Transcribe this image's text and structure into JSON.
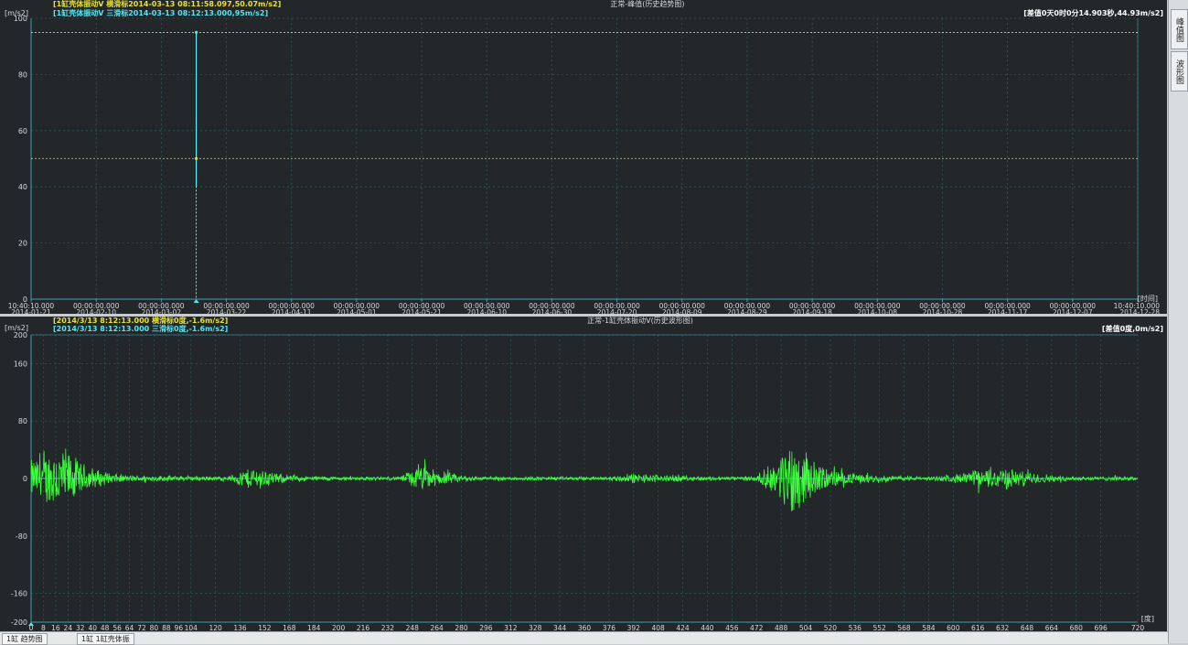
{
  "colors": {
    "bg": "#24272a",
    "axis": "#35a7b8",
    "grid": "#2e5560",
    "text": "#d8d8d8",
    "cursor_yellow": "#e6e232",
    "cursor_cyan": "#52e8f2",
    "wave": "#3cff3c",
    "trend": "#5ff0ff"
  },
  "top": {
    "title": "正常-峰值(历史趋势图)",
    "unit": "[m/s2]",
    "legend1": "[1缸壳体振动V 横滑标2014-03-13 08:11:58.097,50.07m/s2]",
    "legend2": "[1缸壳体振动V 三滑标2014-03-13 08:12:13.000,95m/s2]",
    "delta": "[差值0天0时0分14.903秒,44.93m/s2]",
    "axis_unit": "[时间]",
    "xlabels": [
      {
        "t": "10:40:10.000",
        "d": "2014-01-21"
      },
      {
        "t": "00:00:00.000",
        "d": "2014-02-10"
      },
      {
        "t": "00:00:00.000",
        "d": "2014-03-02"
      },
      {
        "t": "00:00:00.000",
        "d": "2014-03-22"
      },
      {
        "t": "00:00:00.000",
        "d": "2014-04-11"
      },
      {
        "t": "00:00:00.000",
        "d": "2014-05-01"
      },
      {
        "t": "00:00:00.000",
        "d": "2014-05-21"
      },
      {
        "t": "00:00:00.000",
        "d": "2014-06-10"
      },
      {
        "t": "00:00:00.000",
        "d": "2014-06-30"
      },
      {
        "t": "00:00:00.000",
        "d": "2014-07-20"
      },
      {
        "t": "00:00:00.000",
        "d": "2014-08-09"
      },
      {
        "t": "00:00:00.000",
        "d": "2014-08-29"
      },
      {
        "t": "00:00:00.000",
        "d": "2014-09-18"
      },
      {
        "t": "00:00:00.000",
        "d": "2014-10-08"
      },
      {
        "t": "00:00:00.000",
        "d": "2014-10-28"
      },
      {
        "t": "00:00:00.000",
        "d": "2014-11-17"
      },
      {
        "t": "00:00:00.000",
        "d": "2014-12-07"
      },
      {
        "t": "10:40:10.000",
        "d": "2014-12-28"
      }
    ]
  },
  "bottom": {
    "title": "正常-1缸壳体振动V(历史波形图)",
    "unit": "[m/s2]",
    "legend1": "[2014/3/13 8:12:13.000 横滑标0度,-1.6m/s2]",
    "legend2": "[2014/3/13 8:12:13.000 三滑标0度,-1.6m/s2]",
    "delta": "[差值0度,0m/s2]",
    "axis_unit": "[度]"
  },
  "sidebar": {
    "tab1": "峰值图",
    "tab2": "波形图"
  },
  "statusbar": {
    "tab1": "1缸 趋势图",
    "tab2": "1缸 1缸壳体振"
  },
  "chart_data": [
    {
      "type": "line",
      "title": "正常-峰值(历史趋势图)",
      "xlabel": "[时间]",
      "ylabel": "[m/s2]",
      "ylim": [
        0,
        100
      ],
      "yticks": [
        0,
        20,
        40,
        60,
        80,
        100
      ],
      "xlim": [
        "2014-01-21 10:40:10",
        "2014-12-28 10:40:10"
      ],
      "series": [
        {
          "x": [
            "2014-03-13 08:11:58",
            "2014-03-13 08:12:13"
          ],
          "y": [
            50.07,
            95
          ]
        }
      ],
      "cursors": [
        {
          "x": "2014-03-13 08:11:58.097",
          "y": 50.07
        },
        {
          "x": "2014-03-13 08:12:13.000",
          "y": 95
        }
      ],
      "grid": true
    },
    {
      "type": "line",
      "title": "正常-1缸壳体振动V(历史波形图)",
      "xlabel": "[度]",
      "ylabel": "[m/s2]",
      "xlim": [
        0,
        720
      ],
      "ylim": [
        -200,
        200
      ],
      "xticks": [
        0,
        8,
        16,
        24,
        32,
        40,
        48,
        56,
        64,
        72,
        80,
        88,
        96,
        104,
        120,
        136,
        152,
        168,
        184,
        200,
        216,
        232,
        248,
        264,
        280,
        296,
        312,
        328,
        344,
        360,
        376,
        392,
        408,
        424,
        440,
        456,
        472,
        488,
        504,
        520,
        536,
        552,
        568,
        584,
        600,
        616,
        632,
        648,
        664,
        680,
        696,
        720
      ],
      "yticks": [
        -200,
        -160,
        -80,
        0,
        80,
        160,
        200
      ],
      "envelope": {
        "x": [
          0,
          8,
          16,
          24,
          32,
          48,
          64,
          96,
          128,
          136,
          144,
          152,
          160,
          176,
          200,
          240,
          248,
          256,
          264,
          280,
          296,
          320,
          344,
          376,
          392,
          408,
          440,
          472,
          488,
          496,
          504,
          512,
          528,
          552,
          584,
          600,
          608,
          616,
          632,
          648,
          672,
          720
        ],
        "amp": [
          30,
          35,
          55,
          45,
          25,
          10,
          5,
          4,
          3,
          12,
          18,
          15,
          8,
          4,
          3,
          3,
          15,
          20,
          12,
          6,
          3,
          3,
          3,
          3,
          8,
          6,
          3,
          4,
          35,
          70,
          40,
          22,
          10,
          5,
          3,
          6,
          10,
          14,
          18,
          10,
          4,
          3
        ]
      },
      "grid": true
    }
  ]
}
